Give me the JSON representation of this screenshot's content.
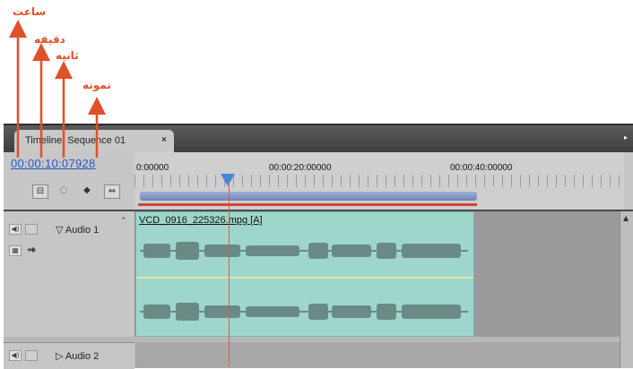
{
  "annotations": [
    {
      "label": "ساعت"
    },
    {
      "label": "دقیقه"
    },
    {
      "label": "ثانیه"
    },
    {
      "label": "نمونه"
    }
  ],
  "panel": {
    "tab_label": "Timeline: Sequence 01",
    "tab_close": "×",
    "menu_icon": "▸"
  },
  "timecode": "00:00:10:07928",
  "ruler": {
    "labels": [
      "0:00000",
      "00:00:20:00000",
      "00:00:40:00000"
    ]
  },
  "tracks": [
    {
      "name": "Audio 1",
      "clip": "VCD_0916_225326.mpg [A]"
    },
    {
      "name": "Audio 2"
    }
  ],
  "colors": {
    "annotation": "#e0502a",
    "timecode": "#2a56c6",
    "clip": "#9fd6cc",
    "playhead": "#4a84d9",
    "playhead_line": "#e05a3a"
  }
}
